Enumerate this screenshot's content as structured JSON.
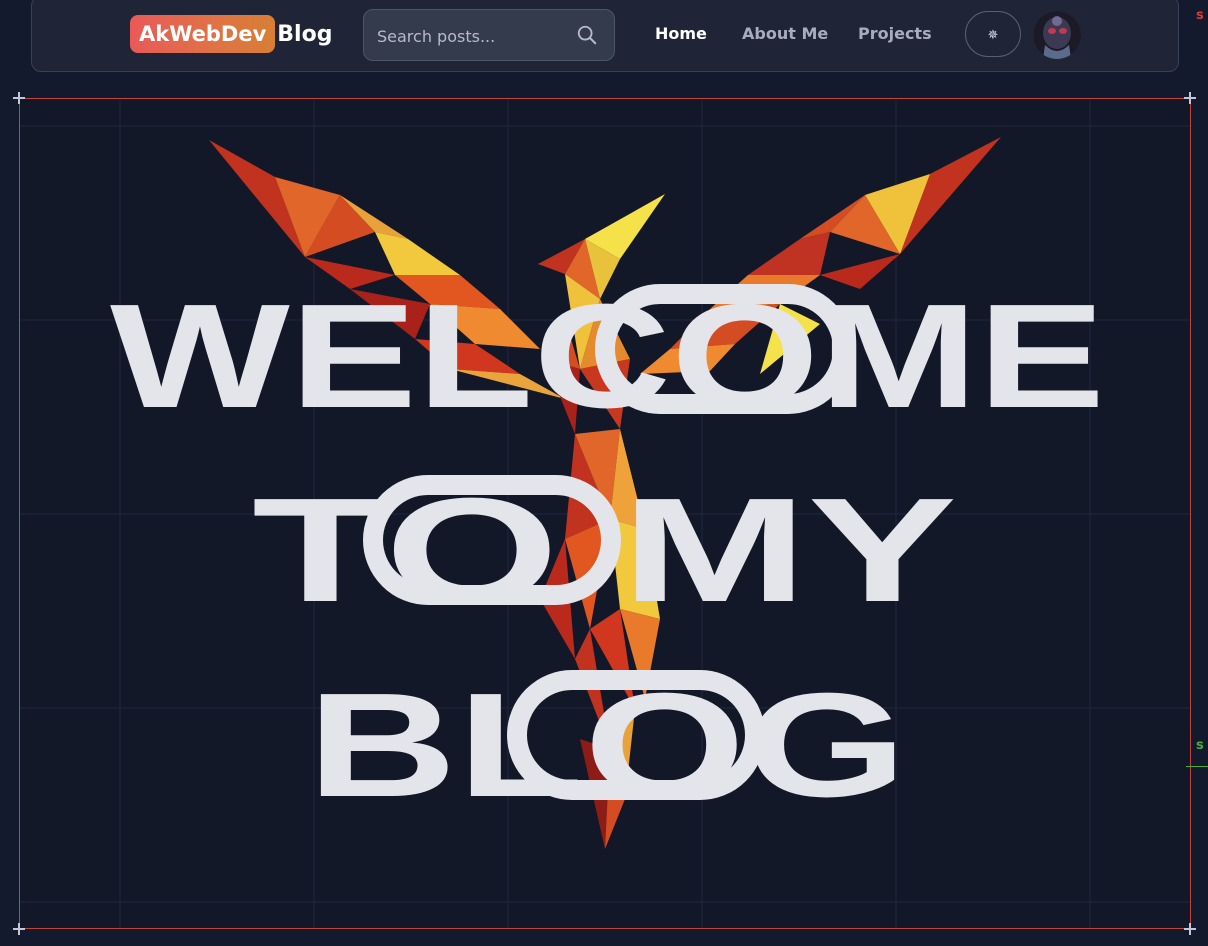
{
  "navbar": {
    "brand_highlight": "AkWebDev",
    "brand_suffix": "Blog",
    "search_placeholder": "Search posts...",
    "links": [
      {
        "label": "Home",
        "active": true
      },
      {
        "label": "About Me",
        "active": false
      },
      {
        "label": "Projects",
        "active": false
      }
    ],
    "theme_toggle_icon": "✵",
    "avatar_icon": "avatar-image"
  },
  "hero": {
    "lines": [
      "WELCOME",
      "TO MY",
      "BLOG"
    ],
    "background": "phoenix-polygon-illustration"
  },
  "colors": {
    "brand_gradient_start": "#e85a58",
    "brand_gradient_end": "#d77f34",
    "page_bg": "#141a2e",
    "hero_text": "#e4e5ea",
    "canvas_border": "#c2453c"
  }
}
